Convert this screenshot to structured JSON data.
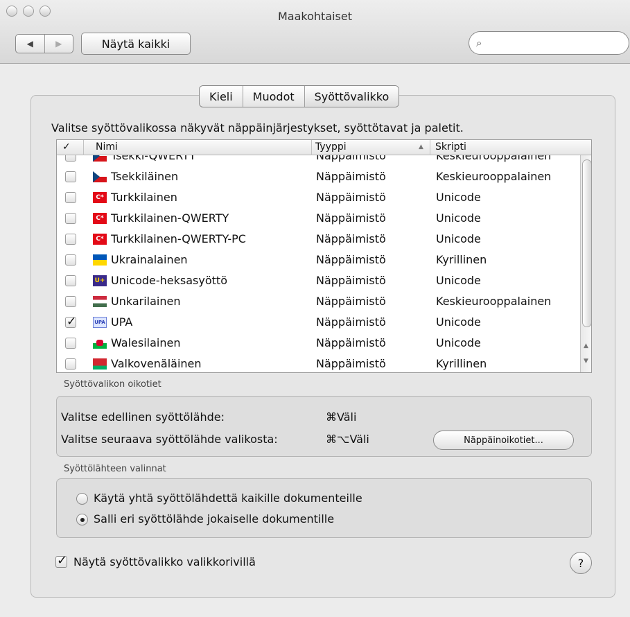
{
  "window": {
    "title": "Maakohtaiset",
    "nav_back": "◀",
    "nav_forward": "▶",
    "show_all_label": "Näytä kaikki",
    "search_icon": "⌕",
    "search_placeholder": ""
  },
  "tabs": [
    {
      "label": "Kieli",
      "selected": false
    },
    {
      "label": "Muodot",
      "selected": false
    },
    {
      "label": "Syöttövalikko",
      "selected": true
    }
  ],
  "intro_text": "Valitse syöttövalikossa näkyvät näppäinjärjestykset, syöttötavat ja paletit.",
  "table": {
    "headers": {
      "check": "✓",
      "name": "Nimi",
      "type": "Tyyppi",
      "sort_icon": "▲",
      "script": "Skripti"
    },
    "rows": [
      {
        "checked": false,
        "flag": "czech-flag",
        "flag_text": "",
        "name": "Tsekki-QWERTY",
        "type": "Näppäimistö",
        "script": "Keskieurooppalainen"
      },
      {
        "checked": false,
        "flag": "czech-flag",
        "flag_text": "",
        "name": "Tsekkiläinen",
        "type": "Näppäimistö",
        "script": "Keskieurooppalainen"
      },
      {
        "checked": false,
        "flag": "turkish-flag",
        "flag_text": "C*",
        "name": "Turkkilainen",
        "type": "Näppäimistö",
        "script": "Unicode"
      },
      {
        "checked": false,
        "flag": "turkish-flag",
        "flag_text": "C*",
        "name": "Turkkilainen-QWERTY",
        "type": "Näppäimistö",
        "script": "Unicode"
      },
      {
        "checked": false,
        "flag": "turkish-flag",
        "flag_text": "C*",
        "name": "Turkkilainen-QWERTY-PC",
        "type": "Näppäimistö",
        "script": "Unicode"
      },
      {
        "checked": false,
        "flag": "ukrainian-flag",
        "flag_text": "",
        "name": "Ukrainalainen",
        "type": "Näppäimistö",
        "script": "Kyrillinen"
      },
      {
        "checked": false,
        "flag": "unicode-flag",
        "flag_text": "U+",
        "name": "Unicode-heksasyöttö",
        "type": "Näppäimistö",
        "script": "Unicode"
      },
      {
        "checked": false,
        "flag": "hungarian-flag",
        "flag_text": "",
        "name": "Unkarilainen",
        "type": "Näppäimistö",
        "script": "Keskieurooppalainen"
      },
      {
        "checked": true,
        "flag": "upa-flag",
        "flag_text": "UPA",
        "name": "UPA",
        "type": "Näppäimistö",
        "script": "Unicode"
      },
      {
        "checked": false,
        "flag": "welsh-flag",
        "flag_text": "",
        "name": "Walesilainen",
        "type": "Näppäimistö",
        "script": "Unicode"
      },
      {
        "checked": false,
        "flag": "belarus-flag",
        "flag_text": "",
        "name": "Valkovenäläinen",
        "type": "Näppäimistö",
        "script": "Kyrillinen"
      }
    ]
  },
  "shortcuts": {
    "section_label": "Syöttövalikon oikotiet",
    "prev_label": "Valitse edellinen syöttölähde:",
    "prev_shortcut": "⌘Väli",
    "next_label": "Valitse seuraava syöttölähde valikosta:",
    "next_shortcut": "⌘⌥Väli",
    "button_label": "Näppäinoikotiet..."
  },
  "source_options": {
    "section_label": "Syöttölähteen valinnat",
    "option_1": "Käytä yhtä syöttölähdettä kaikille dokumenteille",
    "option_2": "Salli eri syöttölähde jokaiselle dokumentille",
    "selected": 2
  },
  "show_menu": {
    "checked": true,
    "label": "Näytä syöttövalikko valikkorivillä"
  },
  "help_label": "?",
  "colors": {
    "accent": "#3875d7",
    "turkish": "#e30a17",
    "czech_blue": "#11457e",
    "ukraine_blue": "#0057b7",
    "ukraine_yellow": "#ffd700"
  }
}
